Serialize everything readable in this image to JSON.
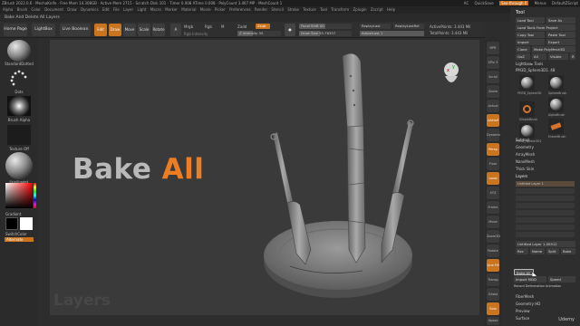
{
  "window": {
    "title": "ZBrush 2022.0.6 · MechaKnife · Free Mem 14.308GB · Active Mem 2715 · Scratch Disk 101 · Timer 0.008 ATime 0.008 · PolyCount 3.467 MP · MeshCount 1",
    "right_controls": [
      "AC",
      "QuickSave",
      "See-through 0",
      "Menus",
      "DefaultZScript"
    ]
  },
  "menubar": [
    "Alpha",
    "Brush",
    "Color",
    "Document",
    "Draw",
    "Dynamics",
    "Edit",
    "File",
    "Layer",
    "Light",
    "Macro",
    "Marker",
    "Material",
    "Movie",
    "Picker",
    "Preferences",
    "Render",
    "Stencil",
    "Stroke",
    "Texture",
    "Tool",
    "Transform",
    "Zplugin",
    "Zscript",
    "Help"
  ],
  "label_bar": "Bake And Delete All Layers",
  "toolbar": {
    "home_page": "Home Page",
    "lightbox": "LightBox",
    "live_boolean": "Live Boolean",
    "edit": "Edit",
    "draw": "Draw",
    "move": "Move",
    "scale": "Scale",
    "rotate": "Rotate",
    "mode_a": "A",
    "mrgb": "Mrgb",
    "rgb": "Rgb",
    "m": "M",
    "zadd": "Zadd",
    "zsub": "Zsub",
    "rgb_intensity": "Rgb Intensity",
    "z_intensity": "Z Intensity 35",
    "focal_shift": "Focal Shift 00",
    "draw_size": "Draw Size 55.76337",
    "replay_last": "ReplayLast",
    "replay_last_rel": "ReplayLastRel",
    "adjust_last": "AdjustLast 1",
    "active_points": "ActivePoints: 3.443 Mil",
    "total_points": "TotalPoints: 3.443 Mil"
  },
  "left_panel": {
    "brush_label": "StandardDotted",
    "stroke_label": "Dots",
    "alpha_label": "Brush Alpha",
    "texture_label": "Texture Off",
    "material_label": "SkinShade4",
    "gradient_label": "Gradient",
    "switch_color_label": "SwitchColor",
    "alternate_label": "Alternate",
    "main_color": "#ff0000"
  },
  "viewport": {
    "heading_part1": "Bake",
    "heading_part2": "All",
    "caption": "Layers",
    "accent": "#ec7d21"
  },
  "right_column": [
    "BPR",
    "SPix 3",
    "Scroll",
    "Zoom",
    "Actual",
    "AAHalf",
    "Dynamic",
    "Persp",
    "Floor",
    "Local",
    "XYZ",
    "Frame",
    "Move",
    "Zoom3D",
    "Rotate",
    "Line Fill",
    "Transp",
    "Ghost",
    "Solo",
    "Xpose"
  ],
  "tool_panel": {
    "title": "Tool",
    "load_tool": "Load Tool",
    "save_as": "Save As",
    "load_tools_from_project": "Load Tools From Project",
    "copy_tool": "Copy Tool",
    "paste_tool": "Paste Tool",
    "import": "Import",
    "export": "Export",
    "clone": "Clone",
    "make_polymesh3d": "Make PolyMesh3D",
    "goz": "GoZ",
    "all": "All",
    "visible": "Visible",
    "r": "R",
    "lightbox_tools": "Lightbox▸ Tools",
    "current_tool": "PM3D_Sphere3D1. 48",
    "tools": [
      "PM3D_Sphere3D",
      "SphereBrush",
      "AlphaBrush",
      "SimpleBrush",
      "EraserBrush",
      "PM3D_Sphere3D1"
    ],
    "sections": [
      "Subtool",
      "Geometry",
      "ArrayMesh",
      "NanoMesh",
      "Thick Skin",
      "Layers"
    ],
    "layer_name": "Untitled Layer 1",
    "layer_intensity": "Untitled Layer 1.00512",
    "layer_buttons": [
      "Rec",
      "Name",
      "Split",
      "Bake"
    ],
    "bake_all": "Bake All",
    "import_mdd": "Import MDD",
    "speed": "Speed",
    "record_deformation": "Record Deformation Animation",
    "bottom_sections": [
      "FiberMesh",
      "Geometry HD",
      "Preview",
      "Surface"
    ]
  },
  "watermark": "Udemy"
}
